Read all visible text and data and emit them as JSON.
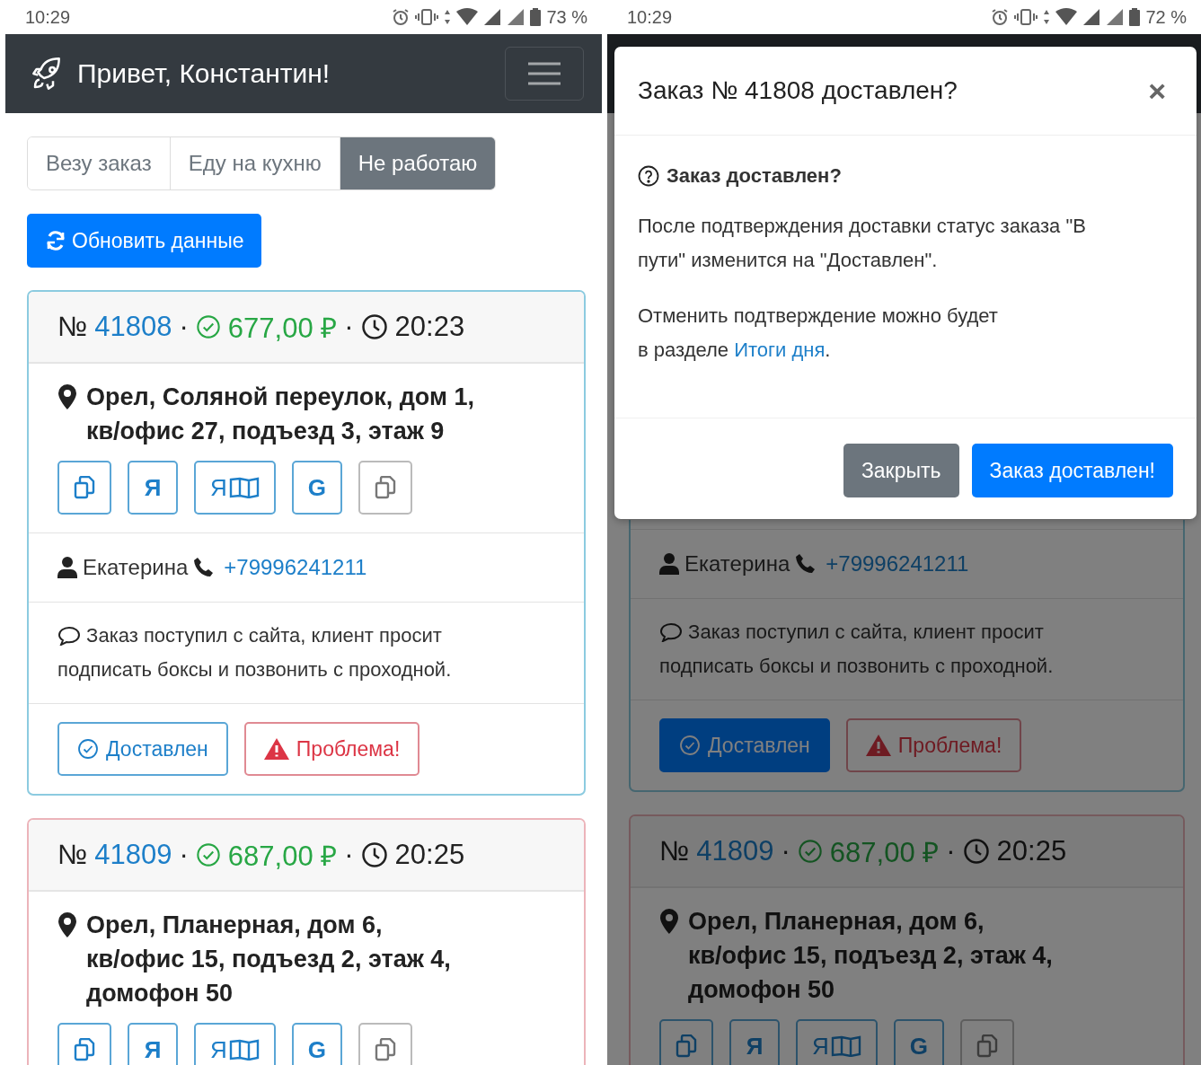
{
  "screens": [
    {
      "status_bar": {
        "time": "10:29",
        "battery": "73 %"
      },
      "navbar": {
        "title": "Привет, Константин!"
      },
      "work_status": [
        {
          "label": "Везу заказ",
          "selected": false
        },
        {
          "label": "Еду на кухню",
          "selected": false
        },
        {
          "label": "Не работаю",
          "selected": true
        }
      ],
      "refresh_button": "Обновить данные",
      "orders": [
        {
          "color": "#8ccbe0",
          "header": {
            "number_sign": "№",
            "number": "41808",
            "separators": [
              "·",
              "·"
            ],
            "sum": "677,00 ₽",
            "time": "20:23"
          },
          "address": "Орел, Соляной переулок, дом 1,\nкв/офис 27, подъезд 3, этаж 9",
          "nav_buttons": [
            {
              "kind": "copy",
              "muted": false
            },
            {
              "kind": "text",
              "muted": false,
              "label": "Я"
            },
            {
              "kind": "text-map",
              "muted": false,
              "label": "Я"
            },
            {
              "kind": "text",
              "muted": false,
              "label": "G"
            },
            {
              "kind": "copy",
              "muted": true
            }
          ],
          "customer": "Екатерина",
          "phone": "+79996241211",
          "comment": "Заказ поступил с сайта, клиент просит\nподписать боксы и позвонить с проходной.",
          "actions": {
            "delivered": {
              "label": "Доставлен",
              "active": false
            },
            "problem": "Проблема!"
          }
        },
        {
          "color": "#ecb4ba",
          "header": {
            "number_sign": "№",
            "number": "41809",
            "separators": [
              "·",
              "·"
            ],
            "sum": "687,00 ₽",
            "time": "20:25"
          },
          "address": "Орел, Планерная, дом 6,\nкв/офис 15, подъезд 2, этаж 4,\nдомофон 50",
          "nav_buttons": [
            {
              "kind": "copy",
              "muted": false
            },
            {
              "kind": "text",
              "muted": false,
              "label": "Я"
            },
            {
              "kind": "text-map",
              "muted": false,
              "label": "Я"
            },
            {
              "kind": "text",
              "muted": false,
              "label": "G"
            },
            {
              "kind": "copy",
              "muted": true
            }
          ]
        }
      ]
    },
    {
      "status_bar": {
        "time": "10:29",
        "battery": "72 %"
      },
      "orders": [
        {
          "color": "#466670",
          "customer": "Екатерина",
          "phone": "+79996241211",
          "comment": "Заказ поступил с сайта, клиент просит\nподписать боксы и позвонить с проходной.",
          "actions": {
            "delivered": {
              "label": "Доставлен",
              "active": true
            },
            "problem": "Проблема!"
          }
        },
        {
          "color": "#765a5d",
          "header": {
            "number_sign": "№",
            "number": "41809",
            "separators": [
              "·",
              "·"
            ],
            "sum": "687,00 ₽",
            "time": "20:25"
          },
          "address": "Орел, Планерная, дом 6,\nкв/офис 15, подъезд 2, этаж 4,\nдомофон 50",
          "nav_buttons": [
            {
              "kind": "copy",
              "muted": false
            },
            {
              "kind": "text",
              "muted": false,
              "label": "Я"
            },
            {
              "kind": "text-map",
              "muted": false,
              "label": "Я"
            },
            {
              "kind": "text",
              "muted": false,
              "label": "G"
            },
            {
              "kind": "copy",
              "muted": true
            }
          ]
        }
      ],
      "modal": {
        "title": "Заказ № 41808 доставлен?",
        "close": "×",
        "question": "Заказ доставлен?",
        "paragraph": "После подтверждения доставки статус заказа \"В\nпути\" изменится на \"Доставлен\".",
        "note": {
          "before": "Отменить подтверждение можно будет\nв разделе ",
          "link": "Итоги дня",
          "after": "."
        },
        "buttons": [
          {
            "label": "Закрыть",
            "kind": "secondary"
          },
          {
            "label": "Заказ доставлен!",
            "kind": "primary"
          }
        ]
      }
    }
  ]
}
